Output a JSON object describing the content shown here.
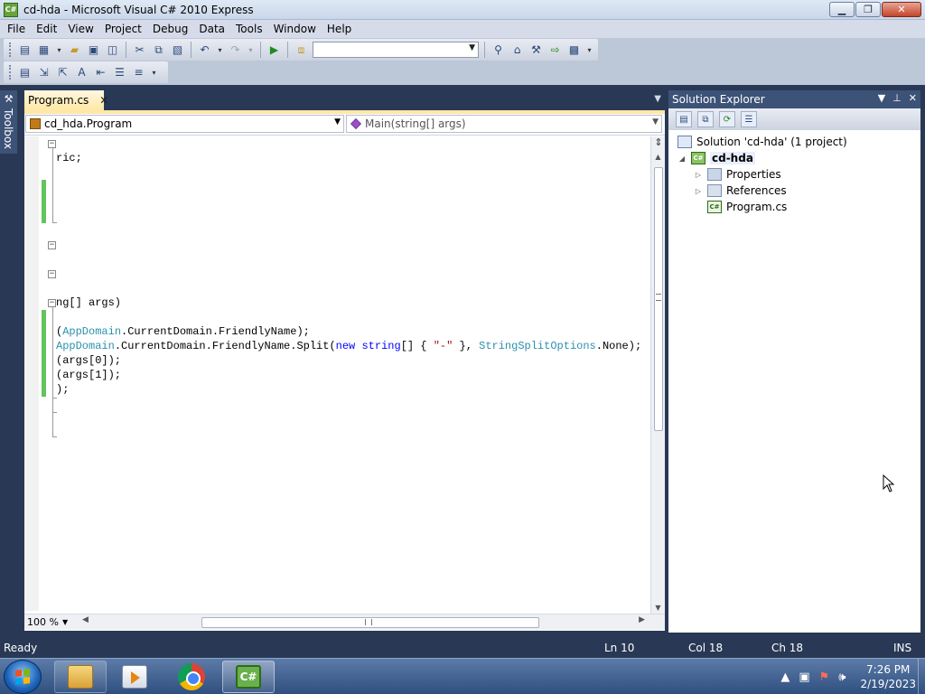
{
  "window": {
    "title": "cd-hda - Microsoft Visual C# 2010 Express",
    "app_icon": "C#"
  },
  "menu": [
    "File",
    "Edit",
    "View",
    "Project",
    "Debug",
    "Data",
    "Tools",
    "Window",
    "Help"
  ],
  "toolbar": {
    "config_combo_value": ""
  },
  "toolbox_strip": {
    "label": "Toolbox"
  },
  "editor": {
    "tab_label": "Program.cs",
    "type_combo": "cd_hda.Program",
    "member_combo": "Main(string[] args)",
    "zoom": "100 %",
    "lines": [
      {
        "segments": [
          {
            "t": "ric;",
            "c": ""
          }
        ]
      },
      {
        "segments": [
          {
            "t": "ng[] args)",
            "c": ""
          }
        ]
      },
      {
        "segments": [
          {
            "t": "(",
            "c": ""
          },
          {
            "t": "AppDomain",
            "c": "ty"
          },
          {
            "t": ".CurrentDomain.FriendlyName);",
            "c": ""
          }
        ]
      },
      {
        "segments": [
          {
            "t": "AppDomain",
            "c": "ty"
          },
          {
            "t": ".CurrentDomain.FriendlyName.Split(",
            "c": ""
          },
          {
            "t": "new",
            "c": "kw"
          },
          {
            "t": " ",
            "c": ""
          },
          {
            "t": "string",
            "c": "kw"
          },
          {
            "t": "[] { ",
            "c": ""
          },
          {
            "t": "\"-\"",
            "c": "st"
          },
          {
            "t": " }, ",
            "c": ""
          },
          {
            "t": "StringSplitOptions",
            "c": "ty"
          },
          {
            "t": ".None);",
            "c": ""
          }
        ]
      },
      {
        "segments": [
          {
            "t": "(args[0]);",
            "c": ""
          }
        ]
      },
      {
        "segments": [
          {
            "t": "(args[1]);",
            "c": ""
          }
        ]
      },
      {
        "segments": [
          {
            "t": ");",
            "c": ""
          }
        ]
      }
    ]
  },
  "solution_explorer": {
    "title": "Solution Explorer",
    "nodes": [
      {
        "label": "Solution 'cd-hda' (1 project)",
        "icon": "solution-icon"
      },
      {
        "label": "cd-hda",
        "icon": "csharp-project-icon"
      },
      {
        "label": "Properties",
        "icon": "properties-folder-icon"
      },
      {
        "label": "References",
        "icon": "references-icon"
      },
      {
        "label": "Program.cs",
        "icon": "csharp-file-icon"
      }
    ]
  },
  "status": {
    "text": "Ready",
    "ln": "Ln 10",
    "col": "Col 18",
    "ch": "Ch 18",
    "mode": "INS"
  },
  "taskbar": {
    "apps": [
      "windows-explorer",
      "windows-media-player",
      "google-chrome",
      "visual-csharp-express"
    ],
    "active_app": "visual-csharp-express",
    "time": "7:26 PM",
    "date": "2/19/2023"
  },
  "colors": {
    "accent": "#293955",
    "tab_active": "#ffe8a6",
    "change_bar": "#62c45c",
    "keyword": "#0000ff",
    "type": "#2b91af",
    "string": "#a31515"
  }
}
